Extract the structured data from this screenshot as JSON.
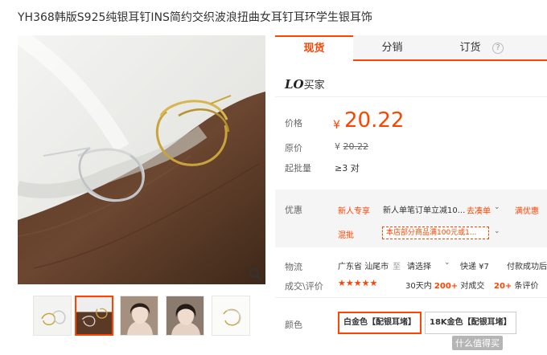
{
  "product": {
    "title": "YH368韩版S925纯银耳钉INS简约交织波浪扭曲女耳钉耳环学生银耳饰"
  },
  "tabs": [
    {
      "label": "现货",
      "active": true
    },
    {
      "label": "分销",
      "active": false
    },
    {
      "label": "订货",
      "active": false,
      "help": "?"
    }
  ],
  "seller": {
    "logo_text": "LO",
    "name": "买家"
  },
  "price": {
    "label": "价格",
    "currency": "¥",
    "value": "20.22",
    "orig_label": "原价",
    "orig_value": "20.22",
    "moq_label": "起批量",
    "moq_value": "≥3 对"
  },
  "promo": {
    "label": "优惠",
    "new_tag": "新人专享",
    "new_text": "新人单笔订单立减10...",
    "new_link": "去凑单",
    "full_discount": "满优惠",
    "mix_tag": "混批",
    "mix_text": "本店部分商品满100元或1..."
  },
  "logistics": {
    "label": "物流",
    "from": "广东省 汕尾市",
    "to_word": "至",
    "to_select": "请选择",
    "express": "快递 ¥7",
    "pay": "付款成功后"
  },
  "deal": {
    "label": "成交\\评价",
    "stars": "★★★★★",
    "days_text": "30天内",
    "count": "200+",
    "count_suffix": "对成交",
    "reviews": "20+",
    "reviews_suffix": "条评价"
  },
  "color": {
    "label": "颜色",
    "options": [
      {
        "label": "白金色【配银耳堵】",
        "selected": true
      },
      {
        "label": "18K金色【配银耳堵】",
        "selected": false
      }
    ]
  },
  "watermark": "什么值得买",
  "colors": {
    "accent": "#ff4400"
  }
}
